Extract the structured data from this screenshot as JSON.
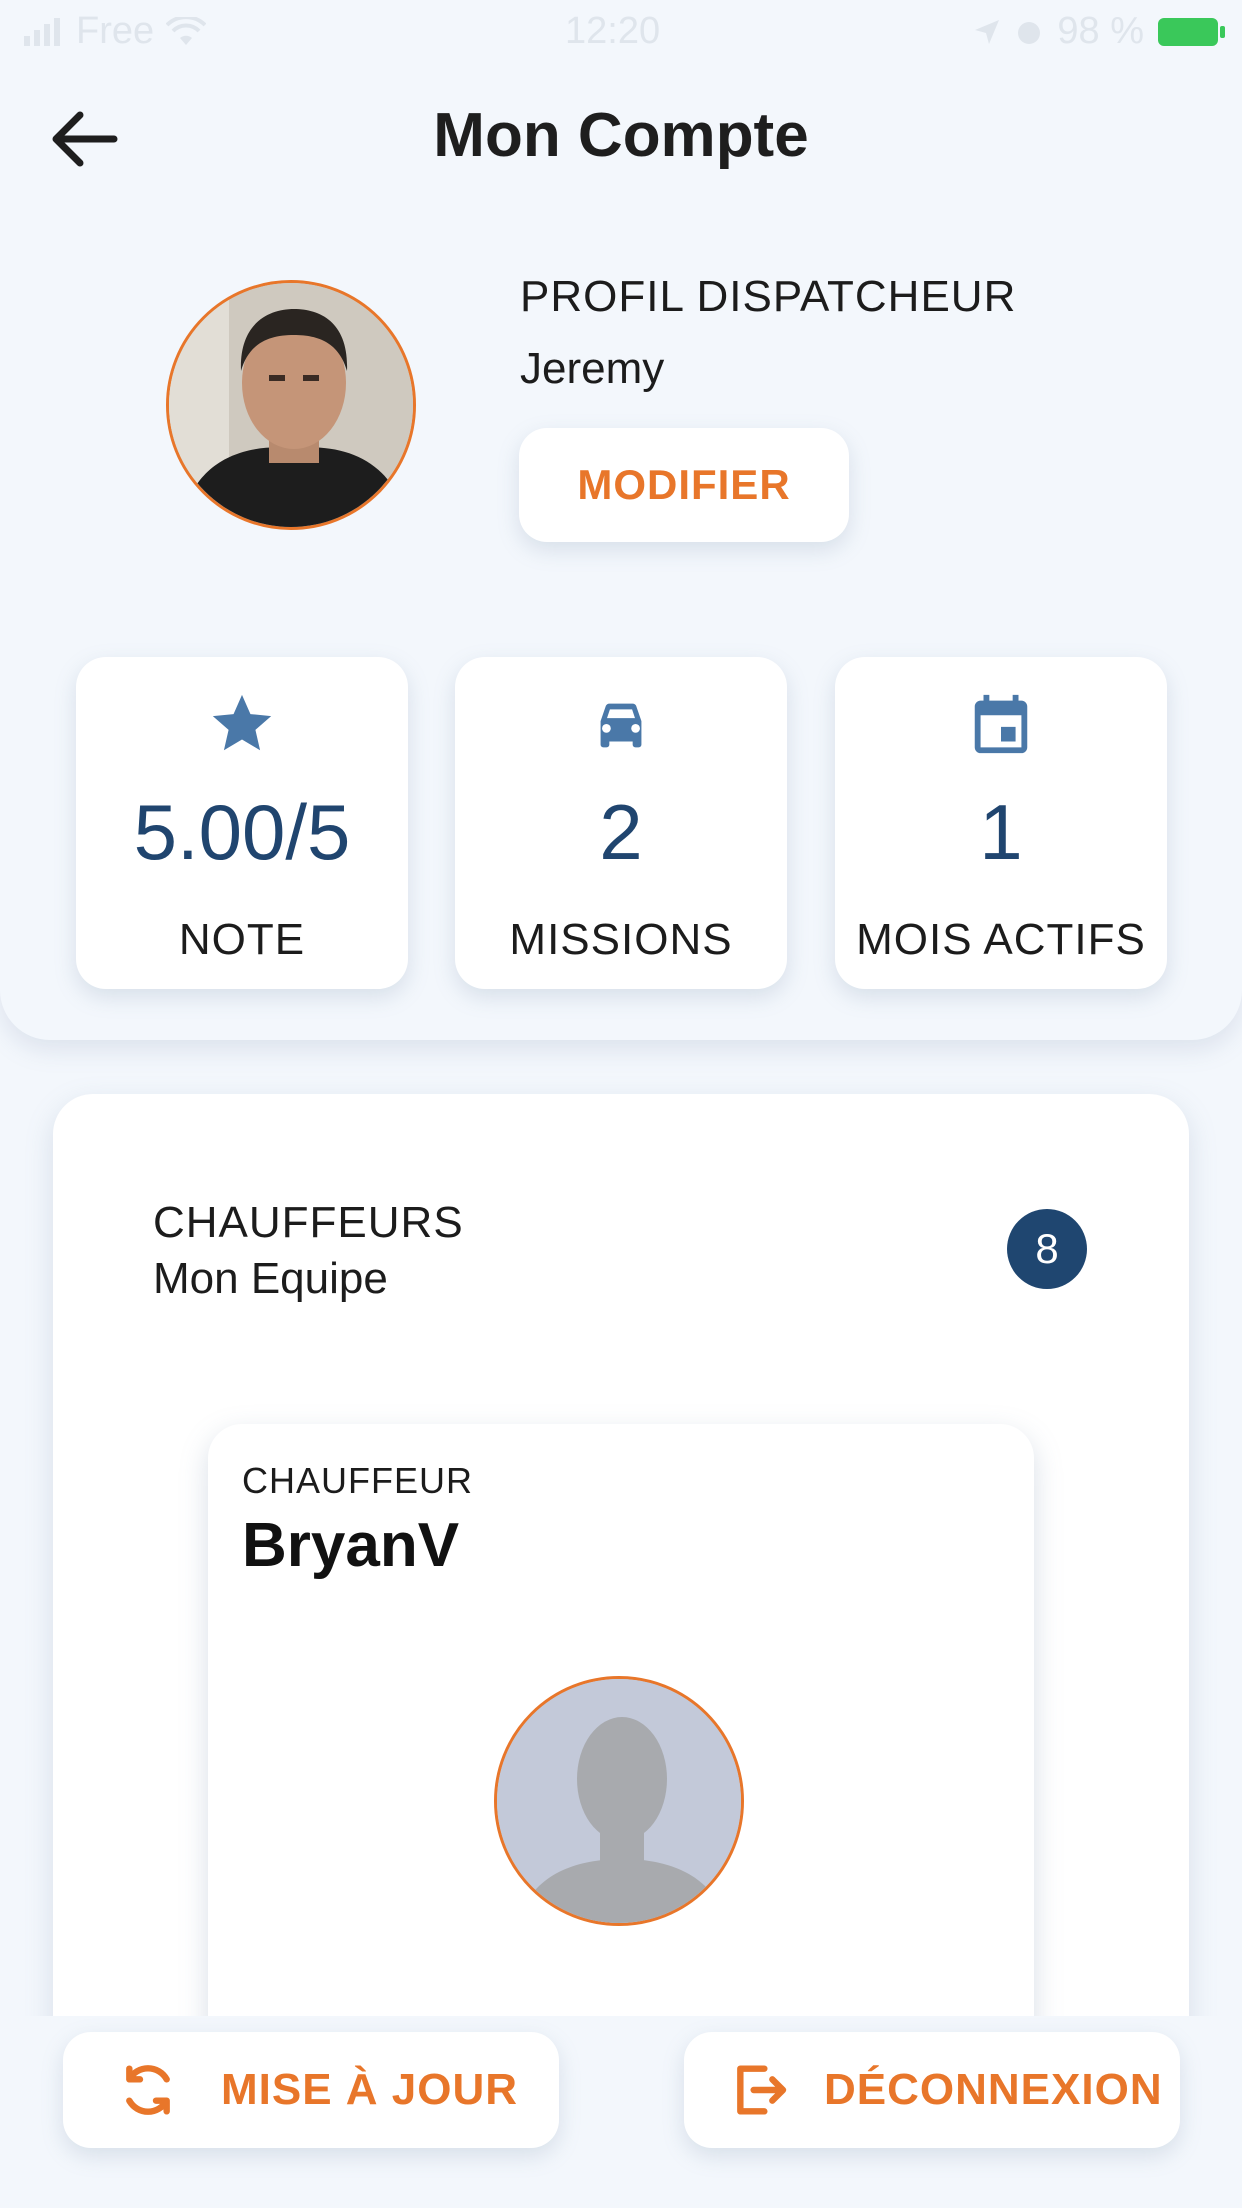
{
  "status_bar": {
    "carrier": "Free",
    "time": "12:20",
    "battery": "98 %"
  },
  "header": {
    "title": "Mon Compte"
  },
  "profile": {
    "role": "PROFIL DISPATCHEUR",
    "name": "Jeremy",
    "modify_label": "MODIFIER"
  },
  "stats": [
    {
      "icon": "star-icon",
      "value": "5.00/5",
      "label": "NOTE"
    },
    {
      "icon": "car-icon",
      "value": "2",
      "label": "MISSIONS"
    },
    {
      "icon": "calendar-icon",
      "value": "1",
      "label": "MOIS ACTIFS"
    }
  ],
  "team": {
    "title": "CHAUFFEURS",
    "subtitle": "Mon Equipe",
    "count": "8",
    "drivers": [
      {
        "role": "CHAUFFEUR",
        "name": "BryanV"
      }
    ]
  },
  "actions": {
    "update_label": "MISE À JOUR",
    "logout_label": "DÉCONNEXION"
  },
  "colors": {
    "accent": "#e8762a",
    "primary": "#20456f",
    "icon": "#4a78a8",
    "background": "#f3f7fc"
  }
}
